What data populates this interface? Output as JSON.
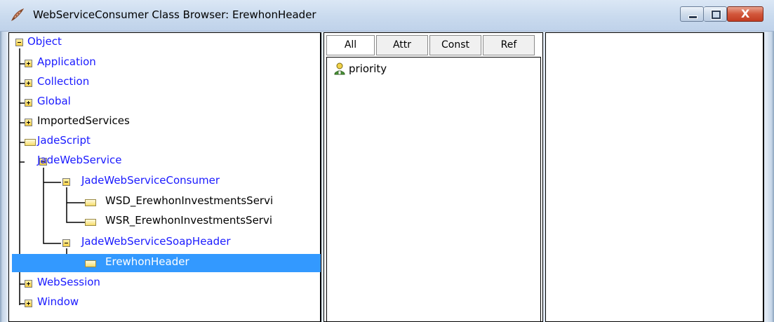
{
  "window": {
    "title": "WebServiceConsumer Class Browser: ErewhonHeader",
    "icon": "app-feather-icon",
    "controls": {
      "minimize_icon": "minimize-icon",
      "maximize_icon": "maximize-icon",
      "close_glyph": "X"
    }
  },
  "tree": {
    "nodes": [
      {
        "label": "Object",
        "state": "expanded"
      },
      {
        "label": "Application",
        "state": "collapsed"
      },
      {
        "label": "Collection",
        "state": "collapsed"
      },
      {
        "label": "Global",
        "state": "collapsed"
      },
      {
        "label": "ImportedServices",
        "state": "collapsed"
      },
      {
        "label": "JadeScript",
        "state": "leaf"
      },
      {
        "label": "JadeWebService",
        "state": "expanded"
      },
      {
        "label": "JadeWebServiceConsumer",
        "state": "expanded"
      },
      {
        "label": "WSD_ErewhonInvestmentsServi",
        "state": "leaf"
      },
      {
        "label": "WSR_ErewhonInvestmentsServi",
        "state": "leaf"
      },
      {
        "label": "JadeWebServiceSoapHeader",
        "state": "expanded"
      },
      {
        "label": "ErewhonHeader",
        "state": "leaf",
        "selected": true
      },
      {
        "label": "WebSession",
        "state": "collapsed"
      },
      {
        "label": "Window",
        "state": "collapsed"
      }
    ]
  },
  "tabs": {
    "all": "All",
    "attr": "Attr",
    "const": "Const",
    "ref": "Ref",
    "active": "All"
  },
  "members": {
    "items": [
      {
        "label": "priority",
        "icon": "public-attribute-icon"
      }
    ]
  },
  "colors": {
    "link": "#1a1aff",
    "selection": "#3399ff"
  }
}
